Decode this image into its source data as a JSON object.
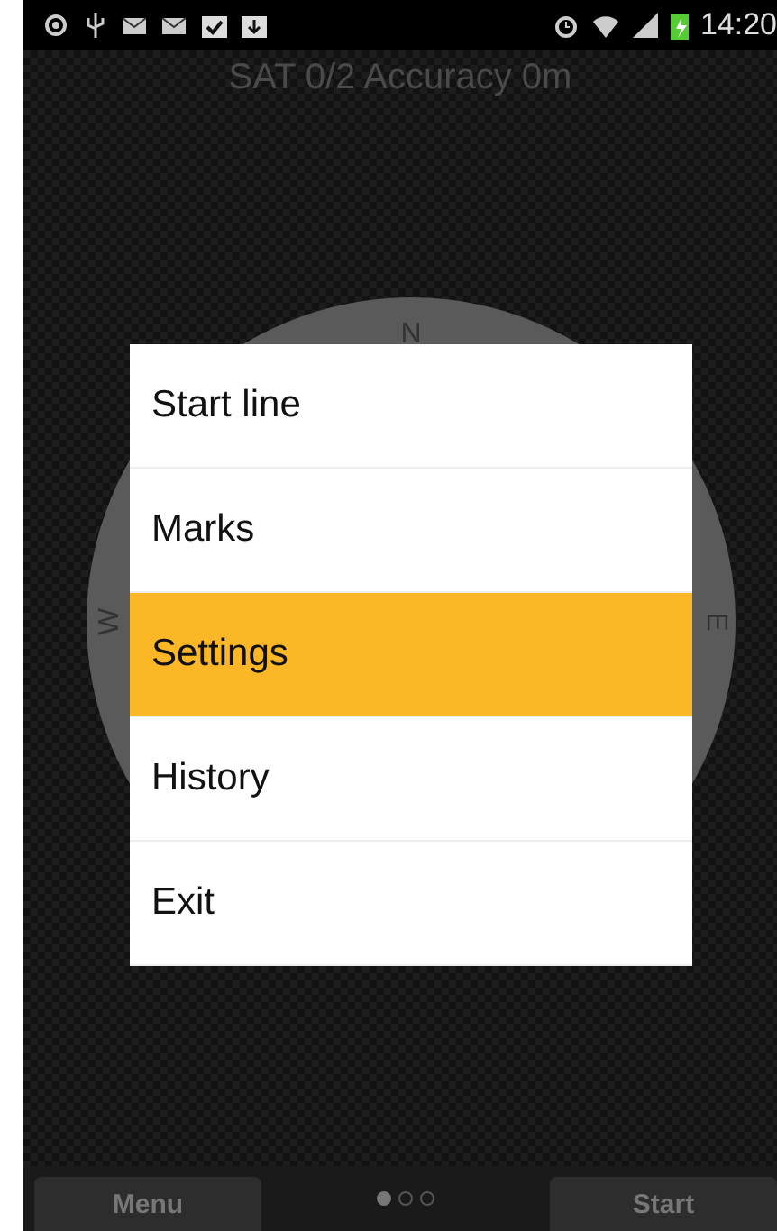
{
  "status_bar": {
    "time": "14:20"
  },
  "gps_status": "SAT 0/2 Accuracy 0m",
  "compass": {
    "north": "N",
    "west": "W",
    "east": "E"
  },
  "menu": {
    "items": [
      {
        "label": "Start line",
        "selected": false
      },
      {
        "label": "Marks",
        "selected": false
      },
      {
        "label": "Settings",
        "selected": true
      },
      {
        "label": "History",
        "selected": false
      },
      {
        "label": "Exit",
        "selected": false
      }
    ]
  },
  "bottom_bar": {
    "left_button": "Menu",
    "right_button": "Start",
    "pages": [
      {
        "selected": true
      },
      {
        "selected": false
      },
      {
        "selected": false
      }
    ]
  }
}
